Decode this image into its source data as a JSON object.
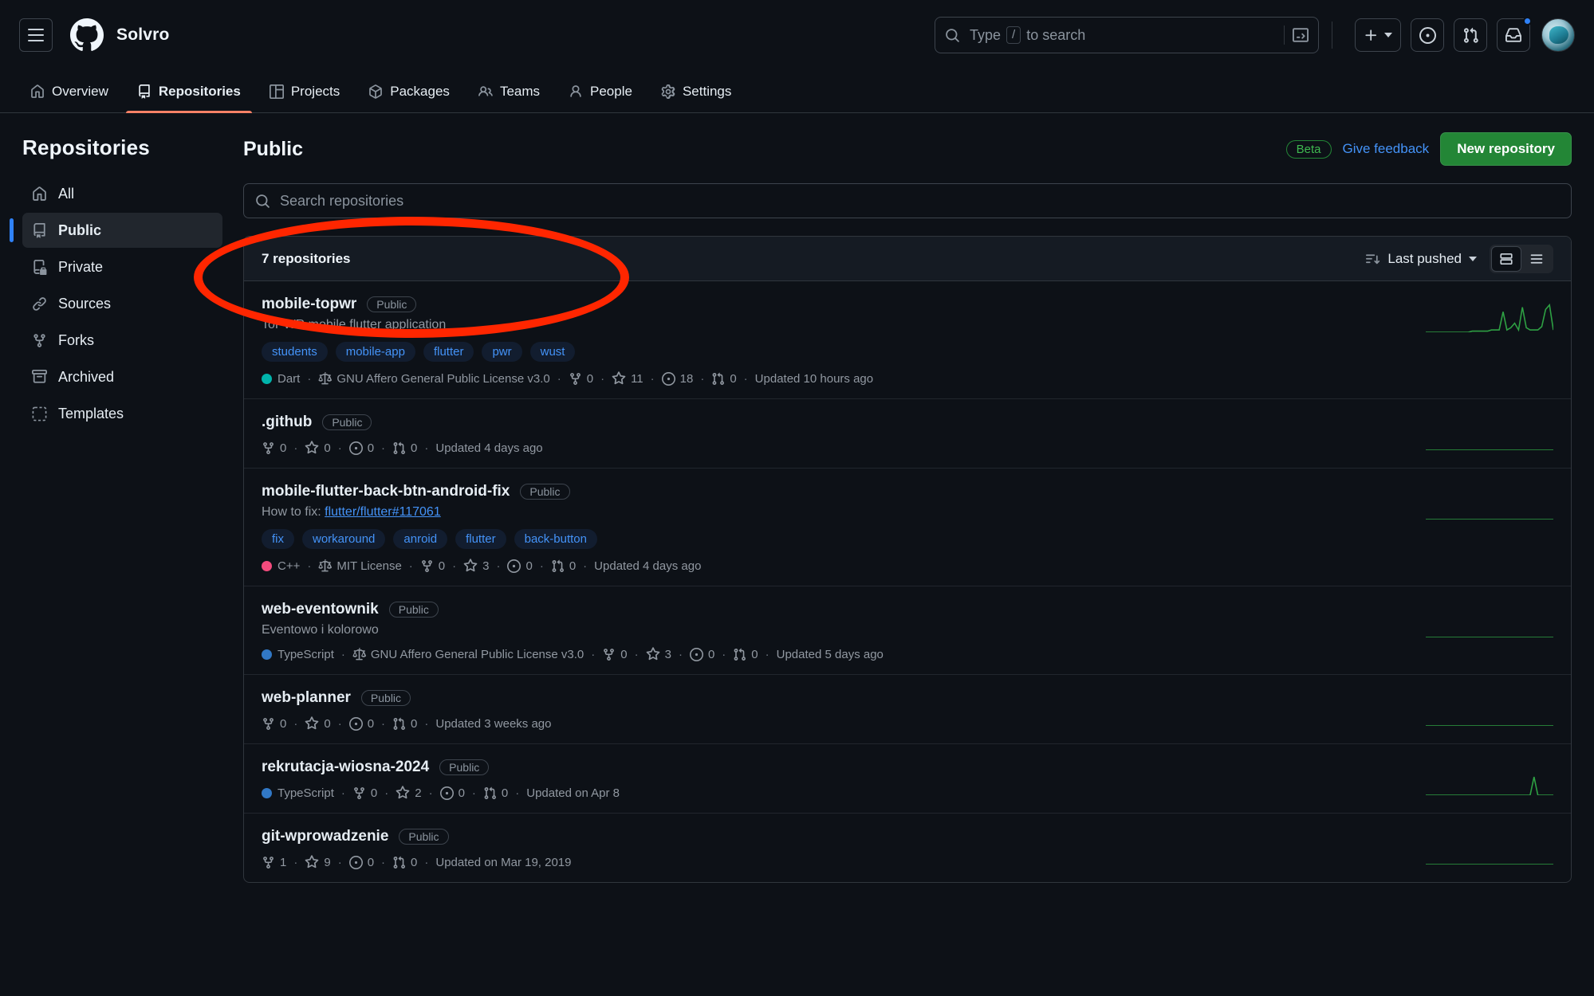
{
  "header": {
    "menu_icon": "hamburger-icon",
    "logo_icon": "github-logo-icon",
    "org_name": "Solvro",
    "search": {
      "placeholder": "Type",
      "slash_key": "/",
      "placeholder_tail": "to search",
      "terminal_icon": "terminal-icon"
    },
    "create_icon": "plus-icon",
    "issues_icon": "issue-opened-icon",
    "pull_requests_icon": "git-pull-request-icon",
    "inbox_icon": "inbox-icon",
    "avatar_icon": "user-avatar"
  },
  "nav": {
    "tabs": [
      {
        "label": "Overview",
        "icon": "home-icon",
        "active": false
      },
      {
        "label": "Repositories",
        "icon": "repo-icon",
        "active": true
      },
      {
        "label": "Projects",
        "icon": "project-icon",
        "active": false
      },
      {
        "label": "Packages",
        "icon": "package-icon",
        "active": false
      },
      {
        "label": "Teams",
        "icon": "people-icon",
        "active": false
      },
      {
        "label": "People",
        "icon": "person-icon",
        "active": false
      },
      {
        "label": "Settings",
        "icon": "gear-icon",
        "active": false
      }
    ]
  },
  "sidebar": {
    "title": "Repositories",
    "items": [
      {
        "label": "All",
        "icon": "home-icon",
        "active": false
      },
      {
        "label": "Public",
        "icon": "repo-icon",
        "active": true
      },
      {
        "label": "Private",
        "icon": "repo-locked-icon",
        "active": false
      },
      {
        "label": "Sources",
        "icon": "link-icon",
        "active": false
      },
      {
        "label": "Forks",
        "icon": "fork-icon",
        "active": false
      },
      {
        "label": "Archived",
        "icon": "archive-icon",
        "active": false
      },
      {
        "label": "Templates",
        "icon": "template-icon",
        "active": false
      }
    ]
  },
  "main": {
    "title": "Public",
    "beta_label": "Beta",
    "feedback_label": "Give feedback",
    "new_repo_label": "New repository",
    "search_placeholder": "Search repositories",
    "repo_count_label": "7 repositories",
    "sort_label": "Last pushed",
    "view_comfortable_icon": "comfortable-view-icon",
    "view_compact_icon": "compact-view-icon"
  },
  "repos": [
    {
      "name": "mobile-topwr",
      "visibility": "Public",
      "description": "ToPWR mobile flutter application",
      "description_link": null,
      "topics": [
        "students",
        "mobile-app",
        "flutter",
        "pwr",
        "wust"
      ],
      "language": "Dart",
      "language_color": "#00b4ab",
      "license": "GNU Affero General Public License v3.0",
      "forks": "0",
      "stars": "11",
      "issues": "18",
      "pulls": "0",
      "updated": "Updated 10 hours ago",
      "sparkline": [
        28,
        28,
        28,
        28,
        28,
        28,
        28,
        28,
        28,
        28,
        28,
        28,
        27,
        27,
        27,
        27,
        27,
        26,
        26,
        26,
        10,
        26,
        24,
        20,
        26,
        6,
        24,
        26,
        26,
        26,
        23,
        8,
        4,
        26
      ]
    },
    {
      "name": ".github",
      "visibility": "Public",
      "description": null,
      "description_link": null,
      "topics": [],
      "language": null,
      "language_color": null,
      "license": null,
      "forks": "0",
      "stars": "0",
      "issues": "0",
      "pulls": "0",
      "updated": "Updated 4 days ago",
      "sparkline": [
        28,
        28,
        28,
        28,
        28,
        28,
        28,
        28,
        28,
        28,
        28,
        28,
        28,
        28,
        28,
        28,
        28,
        28,
        28,
        28,
        28,
        28,
        28,
        28,
        28,
        28,
        28,
        28,
        28,
        28,
        28,
        28,
        28,
        28
      ]
    },
    {
      "name": "mobile-flutter-back-btn-android-fix",
      "visibility": "Public",
      "description": "How to fix: ",
      "description_link": "flutter/flutter#117061",
      "topics": [
        "fix",
        "workaround",
        "anroid",
        "flutter",
        "back-button"
      ],
      "language": "C++",
      "language_color": "#f34b7d",
      "license": "MIT License",
      "forks": "0",
      "stars": "3",
      "issues": "0",
      "pulls": "0",
      "updated": "Updated 4 days ago",
      "sparkline": [
        28,
        28,
        28,
        28,
        28,
        28,
        28,
        28,
        28,
        28,
        28,
        28,
        28,
        28,
        28,
        28,
        28,
        28,
        28,
        28,
        28,
        28,
        28,
        28,
        28,
        28,
        28,
        28,
        28,
        28,
        28,
        28,
        28,
        28
      ]
    },
    {
      "name": "web-eventownik",
      "visibility": "Public",
      "description": "Eventowo i kolorowo",
      "description_link": null,
      "topics": [],
      "language": "TypeScript",
      "language_color": "#3178c6",
      "license": "GNU Affero General Public License v3.0",
      "forks": "0",
      "stars": "3",
      "issues": "0",
      "pulls": "0",
      "updated": "Updated 5 days ago",
      "sparkline": [
        28,
        28,
        28,
        28,
        28,
        28,
        28,
        28,
        28,
        28,
        28,
        28,
        28,
        28,
        28,
        28,
        28,
        28,
        28,
        28,
        28,
        28,
        28,
        28,
        28,
        28,
        28,
        28,
        28,
        28,
        28,
        28,
        28,
        28
      ]
    },
    {
      "name": "web-planner",
      "visibility": "Public",
      "description": null,
      "description_link": null,
      "topics": [],
      "language": null,
      "language_color": null,
      "license": null,
      "forks": "0",
      "stars": "0",
      "issues": "0",
      "pulls": "0",
      "updated": "Updated 3 weeks ago",
      "sparkline": [
        28,
        28,
        28,
        28,
        28,
        28,
        28,
        28,
        28,
        28,
        28,
        28,
        28,
        28,
        28,
        28,
        28,
        28,
        28,
        28,
        28,
        28,
        28,
        28,
        28,
        28,
        28,
        28,
        28,
        28,
        28,
        28,
        28,
        28
      ]
    },
    {
      "name": "rekrutacja-wiosna-2024",
      "visibility": "Public",
      "description": null,
      "description_link": null,
      "topics": [],
      "language": "TypeScript",
      "language_color": "#3178c6",
      "license": null,
      "forks": "0",
      "stars": "2",
      "issues": "0",
      "pulls": "0",
      "updated": "Updated on Apr 8",
      "sparkline": [
        28,
        28,
        28,
        28,
        28,
        28,
        28,
        28,
        28,
        28,
        28,
        28,
        28,
        28,
        28,
        28,
        28,
        28,
        28,
        28,
        28,
        28,
        28,
        28,
        28,
        28,
        28,
        28,
        12,
        28,
        28,
        28,
        28,
        28
      ]
    },
    {
      "name": "git-wprowadzenie",
      "visibility": "Public",
      "description": null,
      "description_link": null,
      "topics": [],
      "language": null,
      "language_color": null,
      "license": null,
      "forks": "1",
      "stars": "9",
      "issues": "0",
      "pulls": "0",
      "updated": "Updated on Mar 19, 2019",
      "sparkline": [
        28,
        28,
        28,
        28,
        28,
        28,
        28,
        28,
        28,
        28,
        28,
        28,
        28,
        28,
        28,
        28,
        28,
        28,
        28,
        28,
        28,
        28,
        28,
        28,
        28,
        28,
        28,
        28,
        28,
        28,
        28,
        28,
        28,
        28
      ]
    }
  ],
  "annotation": {
    "shape": "red-ellipse-highlight"
  },
  "colors": {
    "accent_green": "#238636",
    "accent_blue": "#4493f8",
    "annotation_red": "#ff2600"
  }
}
